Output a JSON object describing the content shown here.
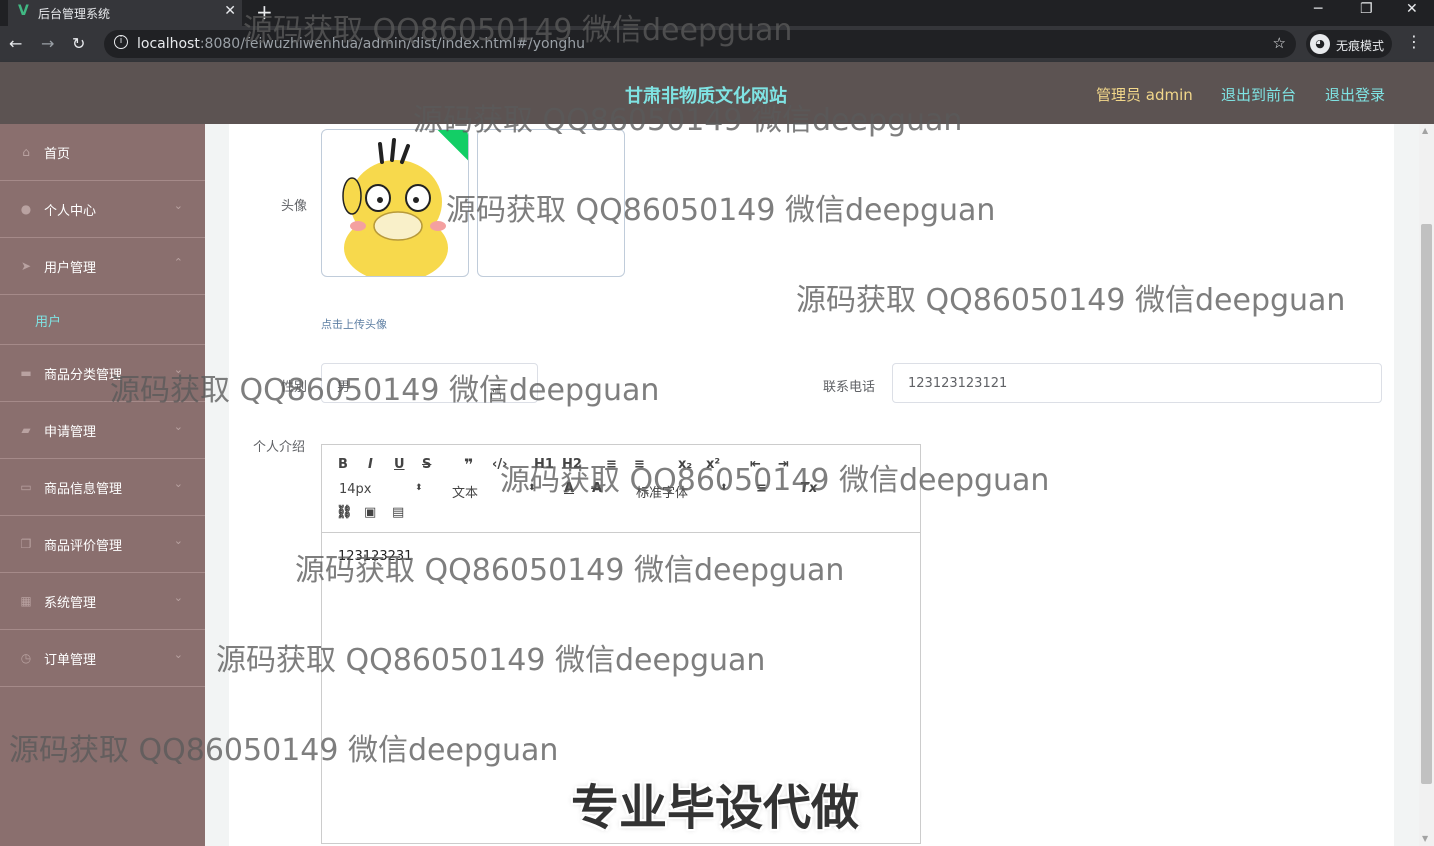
{
  "browser": {
    "tab_title": "后台管理系统",
    "url_host": "localhost",
    "url_rest": ":8080/feiwuzhiwenhua/admin/dist/index.html#/yonghu",
    "incognito_label": "无痕模式"
  },
  "header": {
    "site_title": "甘肃非物质文化网站",
    "admin_label": "管理员 admin",
    "to_frontend": "退出到前台",
    "logout": "退出登录"
  },
  "sidebar": {
    "items": [
      {
        "label": "首页",
        "icon": "home-icon"
      },
      {
        "label": "个人中心",
        "icon": "user-icon"
      },
      {
        "label": "用户管理",
        "icon": "send-icon"
      },
      {
        "label": "用户",
        "icon": ""
      },
      {
        "label": "商品分类管理",
        "icon": "briefcase-icon"
      },
      {
        "label": "申请管理",
        "icon": "chat-icon"
      },
      {
        "label": "商品信息管理",
        "icon": "card-icon"
      },
      {
        "label": "商品评价管理",
        "icon": "copy-icon"
      },
      {
        "label": "系统管理",
        "icon": "grid-icon"
      },
      {
        "label": "订单管理",
        "icon": "clock-icon"
      }
    ]
  },
  "form": {
    "avatar_label": "头像",
    "upload_tip": "点击上传头像",
    "gender_label": "性别",
    "gender_value": "男",
    "phone_label": "联系电话",
    "phone_value": "123123123121",
    "intro_label": "个人介绍",
    "intro_content": "123123231"
  },
  "editor_toolbar": {
    "size_select": "14px",
    "header_select": "文本",
    "font_select": "标准字体"
  },
  "watermark": {
    "text": "源码获取 QQ86050149 微信deepguan",
    "banner": "专业毕设代做"
  }
}
